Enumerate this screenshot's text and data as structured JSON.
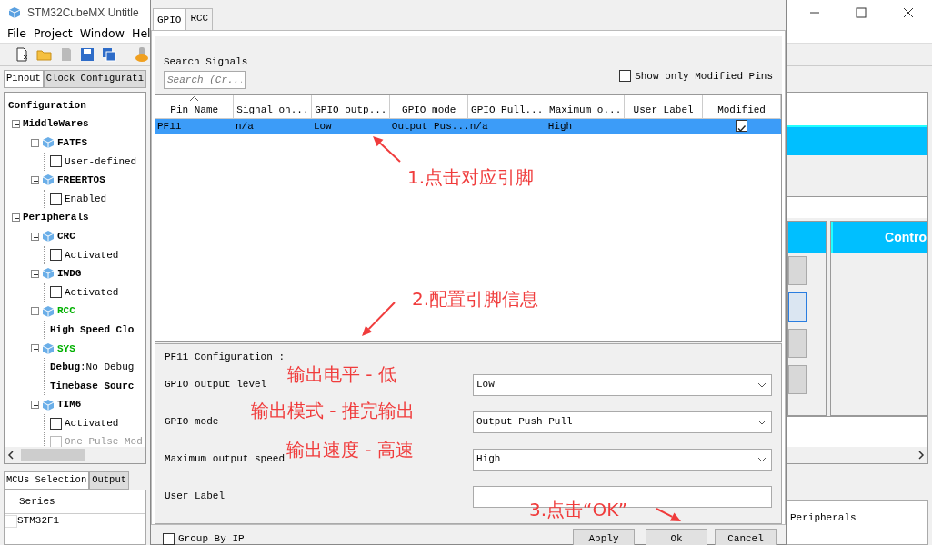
{
  "app": {
    "title": "STM32CubeMX Untitle",
    "menu": [
      "File",
      "Project",
      "Window",
      "Hel"
    ],
    "view_tabs": [
      {
        "label": "Pinout",
        "selected": true
      },
      {
        "label": "Clock Configurati",
        "selected": false
      }
    ],
    "tree": {
      "label": "Configuration",
      "kind": "root",
      "children": [
        {
          "label": "MiddleWares",
          "kind": "group",
          "expanded": true,
          "children": [
            {
              "label": "FATFS",
              "kind": "module",
              "expanded": true,
              "color": "#000000",
              "children": [
                {
                  "label": "User-defined",
                  "kind": "checkbox",
                  "checked": false,
                  "disabled": false
                }
              ]
            },
            {
              "label": "FREERTOS",
              "kind": "module",
              "expanded": true,
              "color": "#000000",
              "children": [
                {
                  "label": "Enabled",
                  "kind": "checkbox",
                  "checked": false,
                  "disabled": false
                }
              ]
            }
          ]
        },
        {
          "label": "Peripherals",
          "kind": "group",
          "expanded": true,
          "children": [
            {
              "label": "CRC",
              "kind": "module",
              "expanded": true,
              "color": "#000000",
              "children": [
                {
                  "label": "Activated",
                  "kind": "checkbox",
                  "checked": false,
                  "disabled": false
                }
              ]
            },
            {
              "label": "IWDG",
              "kind": "module",
              "expanded": true,
              "color": "#000000",
              "children": [
                {
                  "label": "Activated",
                  "kind": "checkbox",
                  "checked": false,
                  "disabled": false
                }
              ]
            },
            {
              "label": "RCC",
              "kind": "module",
              "expanded": true,
              "color": "#00b000",
              "children": [
                {
                  "label": "High Speed Clo",
                  "kind": "setting"
                }
              ]
            },
            {
              "label": "SYS",
              "kind": "module",
              "expanded": true,
              "color": "#00b000",
              "children": [
                {
                  "label": "**Debug**:No Debug",
                  "kind": "setting"
                },
                {
                  "label": "Timebase Sourc",
                  "kind": "setting"
                }
              ]
            },
            {
              "label": "TIM6",
              "kind": "module",
              "expanded": true,
              "color": "#000000",
              "children": [
                {
                  "label": "Activated",
                  "kind": "checkbox",
                  "checked": false,
                  "disabled": false
                },
                {
                  "label": "One Pulse Mod",
                  "kind": "checkbox",
                  "checked": false,
                  "disabled": true
                }
              ]
            }
          ]
        }
      ]
    },
    "bottom_tabs": [
      {
        "label": "MCUs Selection",
        "selected": true
      },
      {
        "label": "Output",
        "selected": false
      }
    ],
    "mcu_table": {
      "columns": [
        "Series"
      ],
      "rows": [
        [
          "STM32F1"
        ]
      ]
    },
    "right_panel": {
      "header": "Contro",
      "table_text": "Peripherals"
    }
  },
  "dialog": {
    "tabs": [
      {
        "label": "GPIO",
        "selected": true
      },
      {
        "label": "RCC",
        "selected": false
      }
    ],
    "search": {
      "label": "Search Signals",
      "placeholder": "Search (Cr..."
    },
    "show_modified": {
      "label": "Show only Modified Pins",
      "checked": false
    },
    "table": {
      "columns": [
        "Pin Name",
        "Signal on...",
        "GPIO outp...",
        "GPIO mode",
        "GPIO Pull...",
        "Maximum o...",
        "User Label",
        "Modified"
      ],
      "rows": [
        {
          "cells": [
            "PF11",
            "n/a",
            "Low",
            "Output Pus...",
            "n/a",
            "High",
            ""
          ],
          "modified": true,
          "selected": true
        }
      ]
    },
    "config": {
      "title": "PF11 Configuration :",
      "fields": [
        {
          "label": "GPIO output level",
          "kind": "select",
          "value": "Low"
        },
        {
          "label": "GPIO mode",
          "kind": "select",
          "value": "Output Push Pull"
        },
        {
          "label": "Maximum output speed",
          "kind": "select",
          "value": "High"
        },
        {
          "label": "User Label",
          "kind": "text"
        }
      ]
    },
    "group_by_ip": {
      "label": "Group By IP",
      "checked": false
    },
    "buttons": [
      "Apply",
      "Ok",
      "Cancel"
    ]
  },
  "annotations": [
    "1.点击对应引脚",
    "2.配置引脚信息",
    "输出电平 - 低",
    "输出模式 - 推完输出",
    "输出速度 - 高速",
    "3.点击“OK”"
  ]
}
